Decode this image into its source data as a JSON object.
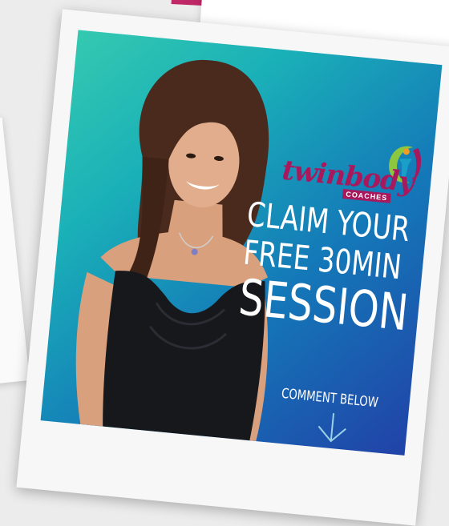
{
  "colors": {
    "brand": "#a8185c",
    "accent_band": "#c02868",
    "photo_gradient_start": "#34c9b0",
    "photo_gradient_end": "#2142a8",
    "text": "#ffffff"
  },
  "logo": {
    "wordmark": "twinbody",
    "subtitle": "COACHES",
    "icon": "figure-logo-icon"
  },
  "headline": {
    "line1": "CLAIM YOUR",
    "line2": "FREE 30MIN",
    "line3": "SESSION"
  },
  "cta": {
    "text": "COMMENT BELOW",
    "icon": "arrow-down-icon"
  },
  "photo": {
    "icon": "woman-portrait-photo"
  }
}
